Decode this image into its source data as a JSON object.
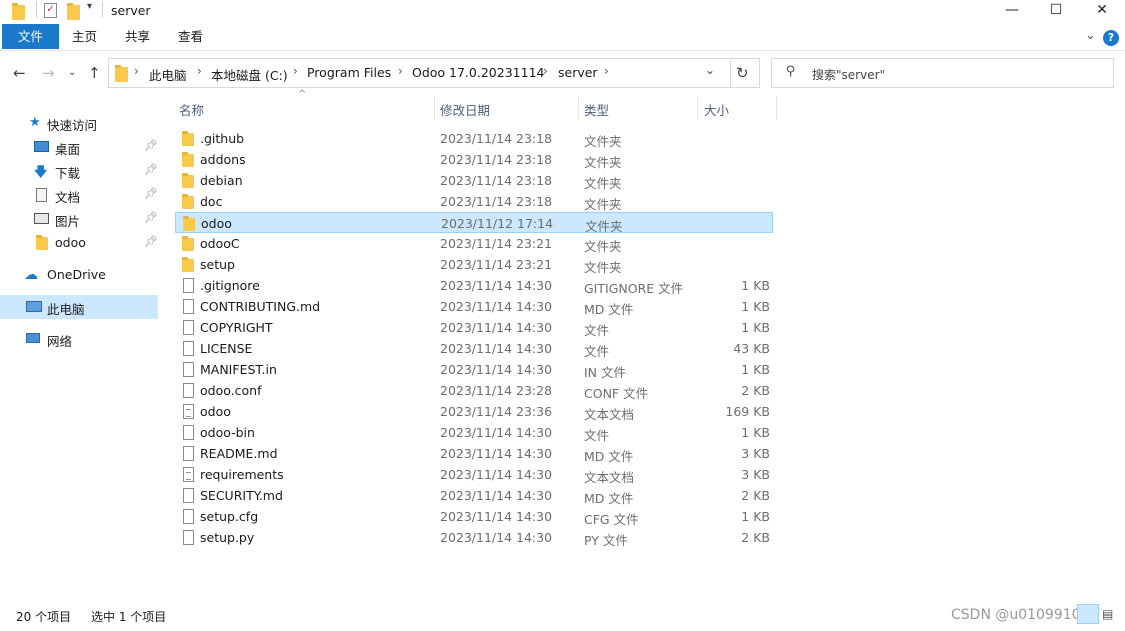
{
  "window": {
    "title": "server",
    "minimize": "—",
    "maximize": "☐",
    "close": "✕"
  },
  "ribbon": {
    "tabs": [
      "文件",
      "主页",
      "共享",
      "查看"
    ],
    "help": "?"
  },
  "address": {
    "crumbs": [
      "此电脑",
      "本地磁盘 (C:)",
      "Program Files",
      "Odoo 17.0.20231114",
      "server"
    ],
    "search_placeholder": "搜索\"server\""
  },
  "navpane": {
    "quick_access": "快速访问",
    "items": [
      {
        "label": "桌面",
        "icon": "desktop-icon",
        "pinned": true
      },
      {
        "label": "下载",
        "icon": "download-icon",
        "pinned": true
      },
      {
        "label": "文档",
        "icon": "documents-icon",
        "pinned": true
      },
      {
        "label": "图片",
        "icon": "pictures-icon",
        "pinned": true
      },
      {
        "label": "odoo",
        "icon": "folder-icon",
        "pinned": true
      }
    ],
    "onedrive": "OneDrive",
    "this_pc": "此电脑",
    "network": "网络"
  },
  "columns": {
    "name": "名称",
    "date": "修改日期",
    "type": "类型",
    "size": "大小"
  },
  "files": [
    {
      "name": ".github",
      "date": "2023/11/14 23:18",
      "type": "文件夹",
      "size": "",
      "kind": "folder"
    },
    {
      "name": "addons",
      "date": "2023/11/14 23:18",
      "type": "文件夹",
      "size": "",
      "kind": "folder"
    },
    {
      "name": "debian",
      "date": "2023/11/14 23:18",
      "type": "文件夹",
      "size": "",
      "kind": "folder"
    },
    {
      "name": "doc",
      "date": "2023/11/14 23:18",
      "type": "文件夹",
      "size": "",
      "kind": "folder"
    },
    {
      "name": "odoo",
      "date": "2023/11/12 17:14",
      "type": "文件夹",
      "size": "",
      "kind": "folder",
      "selected": true
    },
    {
      "name": "odooC",
      "date": "2023/11/14 23:21",
      "type": "文件夹",
      "size": "",
      "kind": "folder"
    },
    {
      "name": "setup",
      "date": "2023/11/14 23:21",
      "type": "文件夹",
      "size": "",
      "kind": "folder"
    },
    {
      "name": ".gitignore",
      "date": "2023/11/14 14:30",
      "type": "GITIGNORE 文件",
      "size": "1 KB",
      "kind": "file"
    },
    {
      "name": "CONTRIBUTING.md",
      "date": "2023/11/14 14:30",
      "type": "MD 文件",
      "size": "1 KB",
      "kind": "file"
    },
    {
      "name": "COPYRIGHT",
      "date": "2023/11/14 14:30",
      "type": "文件",
      "size": "1 KB",
      "kind": "file"
    },
    {
      "name": "LICENSE",
      "date": "2023/11/14 14:30",
      "type": "文件",
      "size": "43 KB",
      "kind": "file"
    },
    {
      "name": "MANIFEST.in",
      "date": "2023/11/14 14:30",
      "type": "IN 文件",
      "size": "1 KB",
      "kind": "file"
    },
    {
      "name": "odoo.conf",
      "date": "2023/11/14 23:28",
      "type": "CONF 文件",
      "size": "2 KB",
      "kind": "file"
    },
    {
      "name": "odoo",
      "date": "2023/11/14 23:36",
      "type": "文本文档",
      "size": "169 KB",
      "kind": "doc"
    },
    {
      "name": "odoo-bin",
      "date": "2023/11/14 14:30",
      "type": "文件",
      "size": "1 KB",
      "kind": "file"
    },
    {
      "name": "README.md",
      "date": "2023/11/14 14:30",
      "type": "MD 文件",
      "size": "3 KB",
      "kind": "file"
    },
    {
      "name": "requirements",
      "date": "2023/11/14 14:30",
      "type": "文本文档",
      "size": "3 KB",
      "kind": "doc"
    },
    {
      "name": "SECURITY.md",
      "date": "2023/11/14 14:30",
      "type": "MD 文件",
      "size": "2 KB",
      "kind": "file"
    },
    {
      "name": "setup.cfg",
      "date": "2023/11/14 14:30",
      "type": "CFG 文件",
      "size": "1 KB",
      "kind": "file"
    },
    {
      "name": "setup.py",
      "date": "2023/11/14 14:30",
      "type": "PY 文件",
      "size": "2 KB",
      "kind": "file"
    }
  ],
  "status": {
    "count": "20 个项目",
    "selected": "选中 1 个项目",
    "watermark": "CSDN @u010991051"
  },
  "colors": {
    "accent": "#1979ca",
    "selection": "#cce8ff",
    "selection_border": "#99d1ff",
    "folder": "#f8c94a"
  }
}
